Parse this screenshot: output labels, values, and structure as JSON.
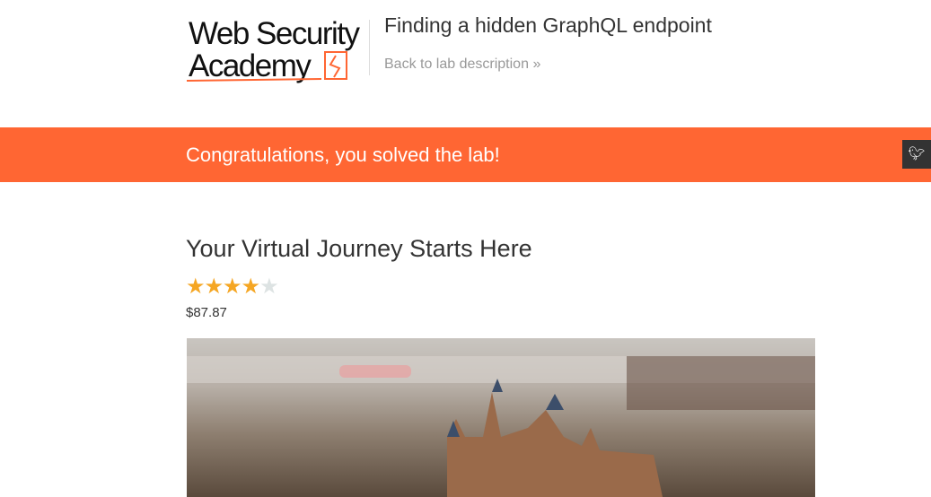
{
  "header": {
    "logo_text": [
      "Web Security",
      "Academy"
    ],
    "title": "Finding a hidden GraphQL endpoint",
    "back_link": "Back to lab description"
  },
  "banner": {
    "message": "Congratulations, you solved the lab!",
    "share_icon": "twitter-icon"
  },
  "product": {
    "title": "Your Virtual Journey Starts Here",
    "rating": 4,
    "rating_max": 5,
    "price": "$87.87",
    "image_alt": "castle"
  },
  "colors": {
    "brand": "#ff6633",
    "star": "#f5a623",
    "star_empty": "#dde3e3"
  }
}
